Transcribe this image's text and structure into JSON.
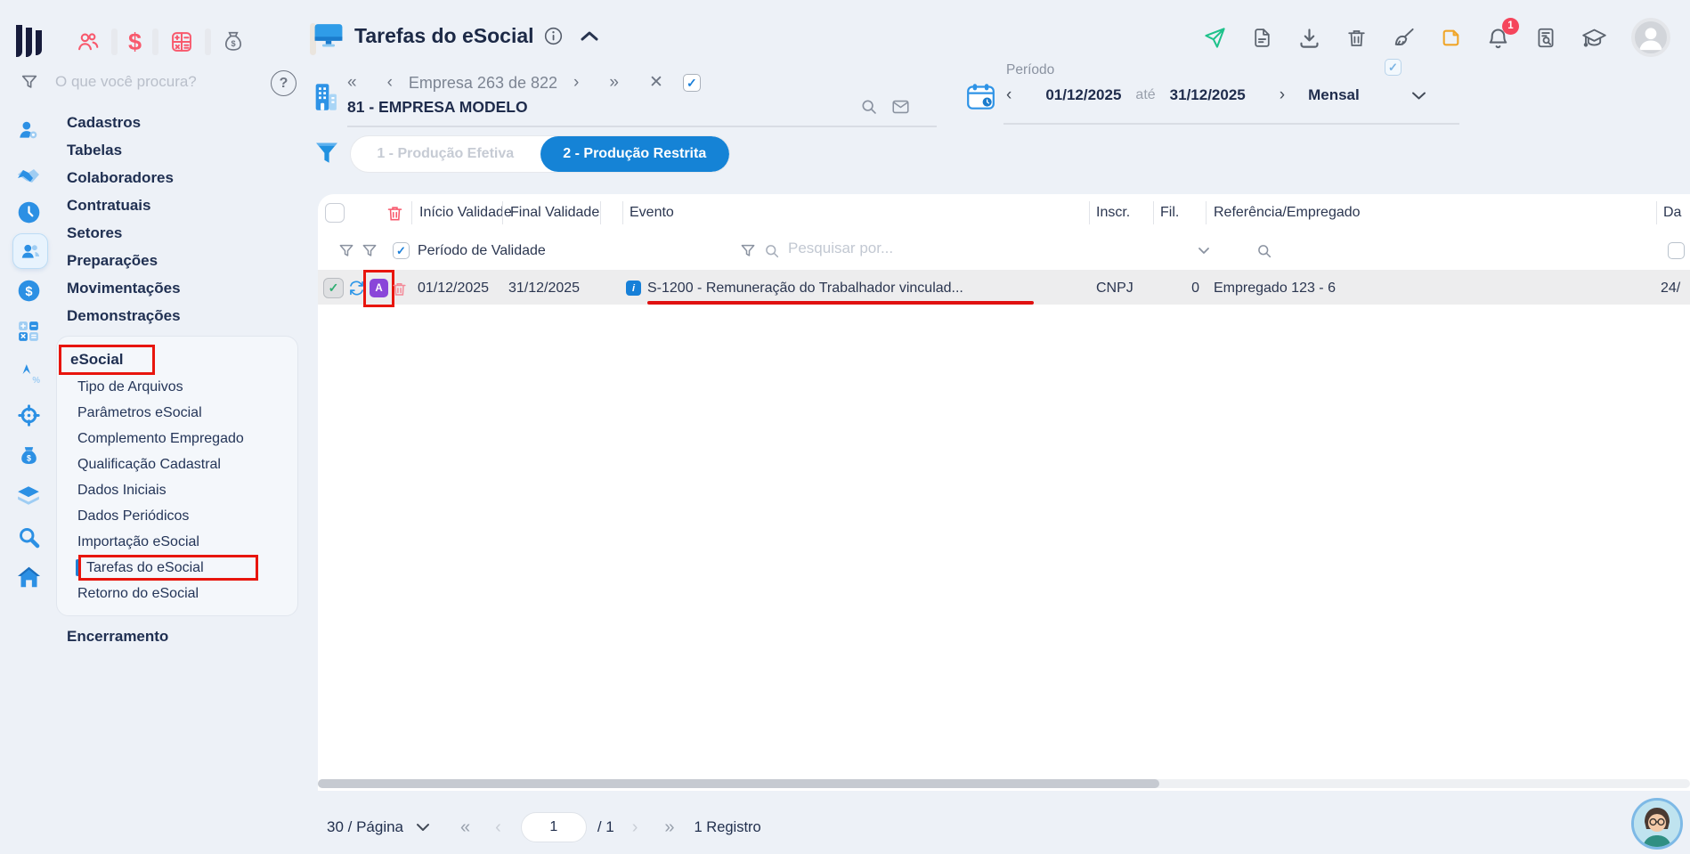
{
  "sidebar": {
    "search_placeholder": "O que você procura?",
    "menu": [
      "Cadastros",
      "Tabelas",
      "Colaboradores",
      "Contratuais",
      "Setores",
      "Preparações",
      "Movimentações",
      "Demonstrações"
    ],
    "esocial": {
      "label": "eSocial",
      "items": [
        "Tipo de Arquivos",
        "Parâmetros eSocial",
        "Complemento Empregado",
        "Qualificação Cadastral",
        "Dados Iniciais",
        "Dados Periódicos",
        "Importação eSocial",
        "Tarefas do eSocial",
        "Retorno do eSocial"
      ],
      "active_item": "Tarefas do eSocial"
    },
    "closing_label": "Encerramento"
  },
  "header": {
    "title": "Tarefas do eSocial",
    "notification_count": "1"
  },
  "company": {
    "counter": "Empresa 263 de 822",
    "name": "81 - EMPRESA MODELO"
  },
  "period": {
    "label": "Período",
    "start": "01/12/2025",
    "until": "até",
    "end": "31/12/2025",
    "mode": "Mensal"
  },
  "tabs": {
    "items": [
      {
        "label": "1 - Produção Efetiva",
        "active": false
      },
      {
        "label": "2 - Produção Restrita",
        "active": true
      }
    ]
  },
  "table": {
    "columns": [
      "Início Validade",
      "Final Validade",
      "Evento",
      "Inscr.",
      "Fil.",
      "Referência/Empregado",
      "Da"
    ],
    "filter": {
      "period_label": "Período de Validade",
      "search_placeholder": "Pesquisar por..."
    },
    "rows": [
      {
        "inicio": "01/12/2025",
        "final": "31/12/2025",
        "badge": "A",
        "info": "i",
        "evento": "S-1200 - Remuneração do Trabalhador vinculad...",
        "inscr": "CNPJ",
        "fil": "0",
        "referencia": "Empregado 123 - 6",
        "da": "24/"
      }
    ]
  },
  "footer": {
    "page_size": "30 / Página",
    "page": "1",
    "total": "/ 1",
    "records": "1 Registro"
  },
  "glyphs": {
    "first": "«",
    "prev": "‹",
    "next": "›",
    "last": "»",
    "close": "✕",
    "check": "✓",
    "question": "?",
    "dollar": "$"
  },
  "icons": {
    "logo": "three-bars-logo",
    "quick": [
      "people-icon",
      "dollar-icon",
      "calculator-icon",
      "money-bag-icon"
    ],
    "top_right": [
      "send-icon",
      "file-icon",
      "download-icon",
      "trash-icon",
      "clean-icon",
      "note-icon",
      "bell-icon",
      "file-search-icon",
      "education-icon",
      "avatar"
    ],
    "rail": [
      "user-gear-icon",
      "handshake-icon",
      "clock-icon",
      "people-card-icon",
      "dollar-circle-icon",
      "calculator-icon",
      "chart-arrow-icon",
      "gear-icon",
      "money-bag-icon",
      "layers-icon",
      "search-icon",
      "home-icon"
    ]
  },
  "colors": {
    "accent_blue": "#1583d6",
    "annotation_red": "#e8150d",
    "badge_purple": "#8a46d9",
    "send_green": "#1ec28b",
    "note_orange": "#f0a528",
    "notification_red": "#f5455c",
    "quick_red": "#f8596d",
    "page_bg": "#edf1f7"
  }
}
